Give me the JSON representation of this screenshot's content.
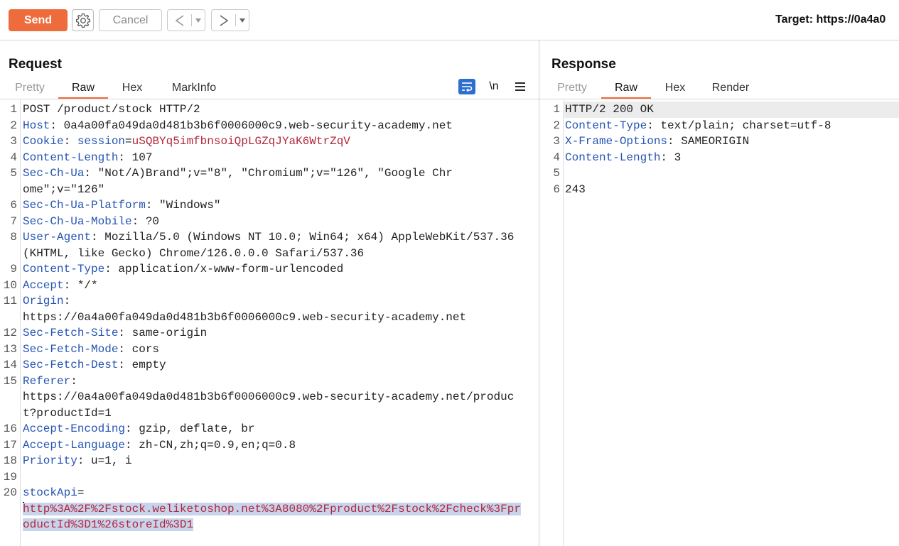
{
  "toolbar": {
    "send_label": "Send",
    "cancel_label": "Cancel",
    "back_glyph": "<",
    "forward_glyph": ">",
    "dropdown_glyph": "▾",
    "target_text": "Target: https://0a4a0"
  },
  "request": {
    "title": "Request",
    "tabs": [
      {
        "label": "Pretty",
        "active": false
      },
      {
        "label": "Raw",
        "active": true
      },
      {
        "label": "Hex",
        "active": false
      },
      {
        "label": "MarkInfo",
        "active": false
      }
    ],
    "newline_label": "\\n",
    "lines": [
      {
        "n": "1",
        "plain": "POST /product/stock HTTP/2"
      },
      {
        "n": "2",
        "name": "Host",
        "value": "0a4a00fa049da0d481b3b6f0006000c9.web-security-academy.net"
      },
      {
        "n": "3",
        "name": "Cookie",
        "cookie_name": "session",
        "cookie_value": "uSQBYq5imfbnsoiQpLGZqJYaK6WtrZqV"
      },
      {
        "n": "4",
        "name": "Content-Length",
        "value": "107"
      },
      {
        "n": "5",
        "name": "Sec-Ch-Ua",
        "value": "\"Not/A)Brand\";v=\"8\", \"Chromium\";v=\"126\", \"Google Chrome\";v=\"126\""
      },
      {
        "n": "6",
        "name": "Sec-Ch-Ua-Platform",
        "value": "\"Windows\""
      },
      {
        "n": "7",
        "name": "Sec-Ch-Ua-Mobile",
        "value": "?0"
      },
      {
        "n": "8",
        "name": "User-Agent",
        "value": "Mozilla/5.0 (Windows NT 10.0; Win64; x64) AppleWebKit/537.36 (KHTML, like Gecko) Chrome/126.0.0.0 Safari/537.36"
      },
      {
        "n": "9",
        "name": "Content-Type",
        "value": "application/x-www-form-urlencoded"
      },
      {
        "n": "10",
        "name": "Accept",
        "value": "*/*"
      },
      {
        "n": "11",
        "name": "Origin",
        "value": "https://0a4a00fa049da0d481b3b6f0006000c9.web-security-academy.net"
      },
      {
        "n": "12",
        "name": "Sec-Fetch-Site",
        "value": "same-origin"
      },
      {
        "n": "13",
        "name": "Sec-Fetch-Mode",
        "value": "cors"
      },
      {
        "n": "14",
        "name": "Sec-Fetch-Dest",
        "value": "empty"
      },
      {
        "n": "15",
        "name": "Referer",
        "value": "https://0a4a00fa049da0d481b3b6f0006000c9.web-security-academy.net/product?productId=1"
      },
      {
        "n": "16",
        "name": "Accept-Encoding",
        "value": "gzip, deflate, br"
      },
      {
        "n": "17",
        "name": "Accept-Language",
        "value": "zh-CN,zh;q=0.9,en;q=0.8"
      },
      {
        "n": "18",
        "name": "Priority",
        "value": "u=1, i"
      },
      {
        "n": "19",
        "plain": ""
      },
      {
        "n": "20",
        "param_name": "stockApi",
        "param_value": "http%3A%2F%2Fstock.weliketoshop.net%3A8080%2Fproduct%2Fstock%2Fcheck%3FproductId%3D1%26storeId%3D1"
      }
    ]
  },
  "response": {
    "title": "Response",
    "tabs": [
      {
        "label": "Pretty",
        "active": false
      },
      {
        "label": "Raw",
        "active": true
      },
      {
        "label": "Hex",
        "active": false
      },
      {
        "label": "Render",
        "active": false
      }
    ],
    "lines": [
      {
        "n": "1",
        "plain": "HTTP/2 200 OK"
      },
      {
        "n": "2",
        "name": "Content-Type",
        "value": "text/plain; charset=utf-8"
      },
      {
        "n": "3",
        "name": "X-Frame-Options",
        "value": "SAMEORIGIN"
      },
      {
        "n": "4",
        "name": "Content-Length",
        "value": "3"
      },
      {
        "n": "5",
        "plain": ""
      },
      {
        "n": "6",
        "plain": "243"
      }
    ]
  },
  "colors": {
    "send_button": "#ee6b3b",
    "active_tab_underline": "#ee6b3b",
    "header_name": "#2554b4",
    "cookie_value": "#b2283b",
    "selection_highlight": "#c8d3ec",
    "wrap_icon_bg": "#2d6fcf"
  },
  "icons": [
    "gear-icon",
    "back-arrow-icon",
    "forward-arrow-icon",
    "chevron-down-icon",
    "word-wrap-icon",
    "newline-icon",
    "menu-icon"
  ]
}
